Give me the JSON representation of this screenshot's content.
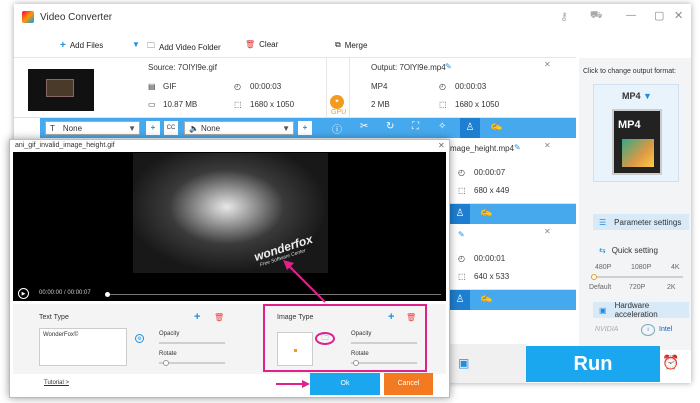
{
  "app": {
    "title": "Video Converter"
  },
  "toolbar": {
    "add_files": "Add Files",
    "add_folder": "Add Video Folder",
    "clear": "Clear",
    "merge": "Merge"
  },
  "row1": {
    "source": "Source: 7OlYl9e.gif",
    "output": "Output: 7OlYl9e.mp4",
    "src_fmt": "GIF",
    "src_dur": "00:00:03",
    "src_size": "10.87 MB",
    "src_res": "1680 x 1050",
    "out_fmt": "MP4",
    "out_dur": "00:00:03",
    "out_size": "2 MB",
    "out_res": "1680 x 1050",
    "gpu": "GPU"
  },
  "row2": {
    "output": "mage_height.mp4",
    "dur": "00:00:07",
    "res": "680 x 449"
  },
  "row3": {
    "dur": "00:00:01",
    "res": "640 x 533"
  },
  "editbar": {
    "subtitle": "None",
    "audio": "None"
  },
  "right": {
    "hint": "Click to change output format:",
    "format": "MP4",
    "param": "Parameter settings",
    "quick": "Quick setting",
    "q480": "480P",
    "q1080": "1080P",
    "q4k": "4K",
    "qdefault": "Default",
    "q720": "720P",
    "q2k": "2K",
    "hw": "Hardware acceleration",
    "nvidia": "NVIDIA",
    "intel": "Intel",
    "run": "Run"
  },
  "dialog": {
    "title": "ani_gif_invalid_image_height.gif",
    "time": "00:00:00 / 00:00:07",
    "watermark": "wonderfox",
    "watermark_sub": "Free Software Center",
    "text_type": "Text Type",
    "text_value": "WonderFox©",
    "opacity": "Opacity",
    "rotate": "Rotate",
    "image_type": "Image Type",
    "img_opacity": "Opacity",
    "img_rotate": "Rotate",
    "tutorial": "Tutorial >",
    "ok": "Ok",
    "cancel": "Cancel"
  }
}
